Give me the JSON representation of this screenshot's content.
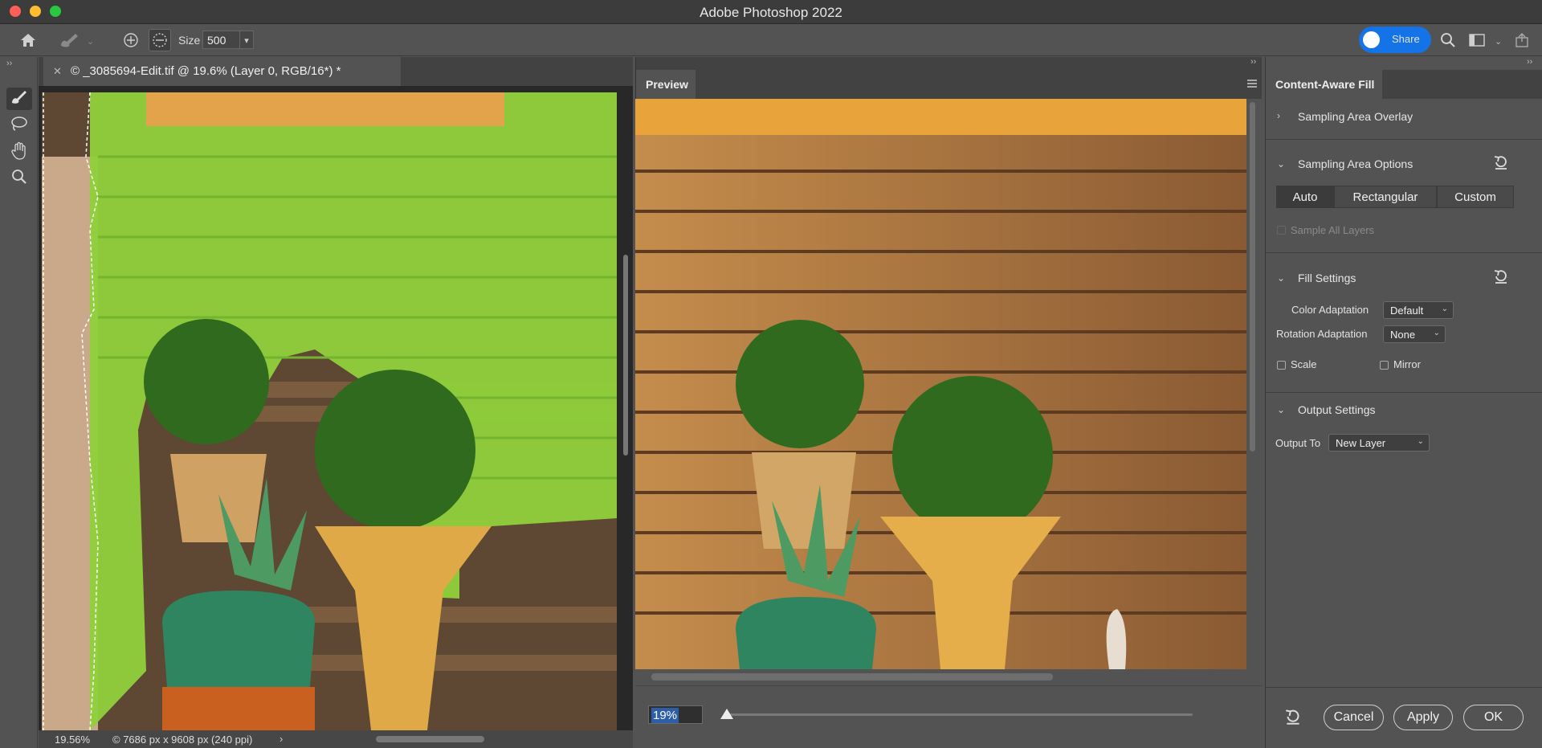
{
  "window": {
    "title": "Adobe Photoshop 2022"
  },
  "toolbar": {
    "size_label": "Size",
    "size_value": "500",
    "share_label": "Share",
    "icons": [
      "home-icon",
      "brush-icon",
      "add-circle-icon",
      "subtract-circle-icon",
      "search-icon",
      "workspace-icon",
      "export-icon"
    ]
  },
  "document": {
    "tab_title": "© _3085694-Edit.tif @ 19.6% (Layer 0, RGB/16*) *",
    "zoom_status": "19.56%",
    "info_status": "© 7686 px x 9608 px (240 ppi)"
  },
  "preview": {
    "tab_label": "Preview",
    "zoom_value": "19%",
    "zoom_fraction": 0.14
  },
  "panel": {
    "tab_label": "Content-Aware Fill",
    "sampling_overlay": "Sampling Area Overlay",
    "sampling_options": "Sampling Area Options",
    "modes": [
      "Auto",
      "Rectangular",
      "Custom"
    ],
    "selected_mode": "Auto",
    "sample_all_layers": "Sample All Layers",
    "fill_settings": "Fill Settings",
    "color_adaptation_label": "Color Adaptation",
    "color_adaptation_value": "Default",
    "rotation_adaptation_label": "Rotation Adaptation",
    "rotation_adaptation_value": "None",
    "scale_label": "Scale",
    "mirror_label": "Mirror",
    "output_settings": "Output Settings",
    "output_to_label": "Output To",
    "output_to_value": "New Layer"
  },
  "footer": {
    "cancel": "Cancel",
    "apply": "Apply",
    "ok": "OK"
  }
}
